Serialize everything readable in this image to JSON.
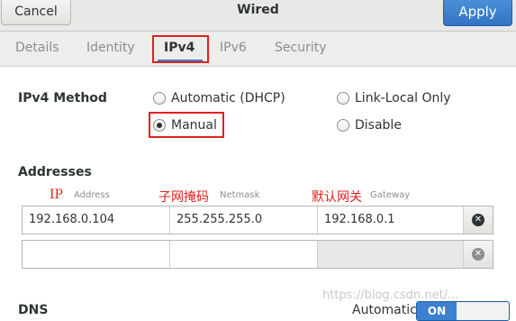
{
  "header": {
    "cancel_label": "Cancel",
    "title": "Wired",
    "apply_label": "Apply"
  },
  "tabs": [
    {
      "label": "Details"
    },
    {
      "label": "Identity"
    },
    {
      "label": "IPv4"
    },
    {
      "label": "IPv6"
    },
    {
      "label": "Security"
    }
  ],
  "active_tab": "IPv4",
  "ipv4_method": {
    "label": "IPv4 Method",
    "options": [
      {
        "label": "Automatic (DHCP)",
        "selected": false
      },
      {
        "label": "Link-Local Only",
        "selected": false
      },
      {
        "label": "Manual",
        "selected": true
      },
      {
        "label": "Disable",
        "selected": false
      }
    ]
  },
  "addresses": {
    "section_label": "Addresses",
    "column_headers": [
      "Address",
      "Netmask",
      "Gateway"
    ],
    "annotations": [
      "IP",
      "子网掩码",
      "默认网关"
    ],
    "rows": [
      {
        "address": "192.168.0.104",
        "netmask": "255.255.255.0",
        "gateway": "192.168.0.1"
      },
      {
        "address": "",
        "netmask": "",
        "gateway": ""
      }
    ],
    "delete_icon": "close-circle-icon"
  },
  "dns": {
    "section_label": "DNS",
    "automatic_label": "Automatic",
    "switch_label": "ON"
  },
  "watermark": "https://blog.csdn.net/...",
  "colors": {
    "accent": "#3c80cf",
    "annotation_red": "#e02020"
  }
}
